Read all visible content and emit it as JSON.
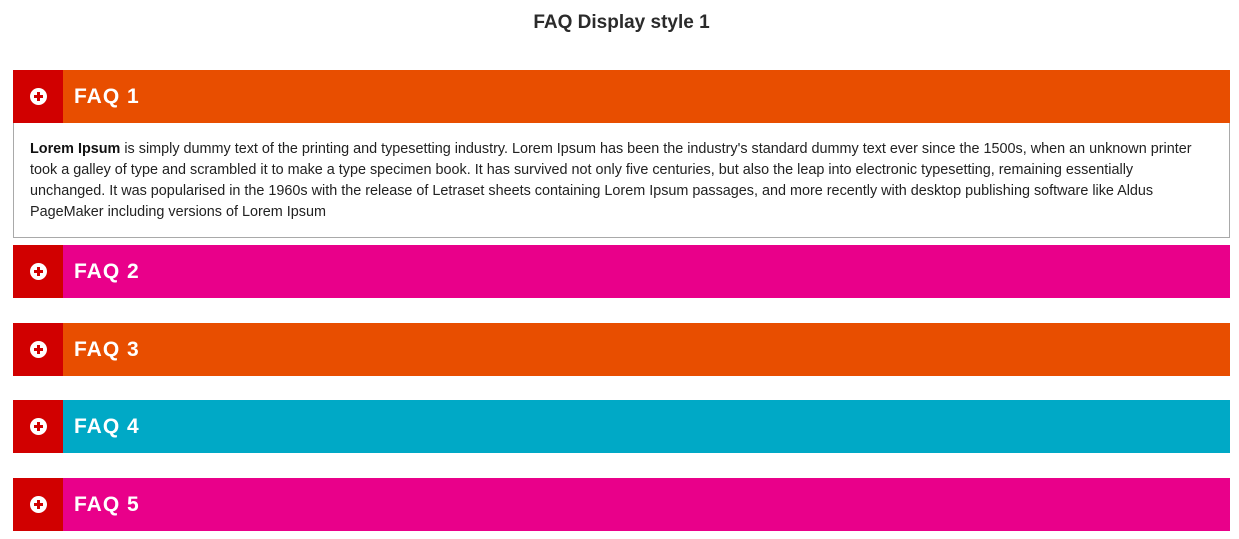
{
  "page": {
    "title": "FAQ Display style 1"
  },
  "colors": {
    "toggle": "#d10000",
    "orange": "#e84e00",
    "pink": "#e9008a",
    "teal": "#00a9c6"
  },
  "faqs": [
    {
      "title": "FAQ 1",
      "color": "#e84e00",
      "expanded": true,
      "icon": "plus-circle-icon",
      "answer_lead": "Lorem Ipsum",
      "answer_text": " is simply dummy text of the printing and typesetting industry. Lorem Ipsum has been the industry's standard dummy text ever since the 1500s, when an unknown printer took a galley of type and scrambled it to make a type specimen book. It has survived not only five centuries, but also the leap into electronic typesetting, remaining essentially unchanged. It was popularised in the 1960s with the release of Letraset sheets containing Lorem Ipsum passages, and more recently with desktop publishing software like Aldus PageMaker including versions of Lorem Ipsum"
    },
    {
      "title": "FAQ 2",
      "color": "#e9008a",
      "expanded": false,
      "icon": "plus-circle-icon"
    },
    {
      "title": "FAQ 3",
      "color": "#e84e00",
      "expanded": false,
      "icon": "plus-circle-icon"
    },
    {
      "title": "FAQ 4",
      "color": "#00a9c6",
      "expanded": false,
      "icon": "plus-circle-icon"
    },
    {
      "title": "FAQ 5",
      "color": "#e9008a",
      "expanded": false,
      "icon": "plus-circle-icon"
    }
  ]
}
